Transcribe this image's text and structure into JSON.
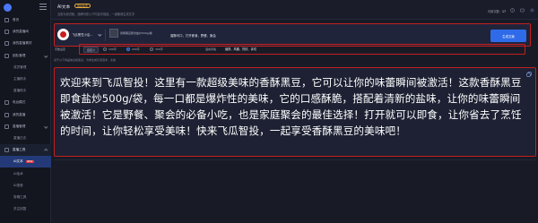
{
  "header": {
    "title": "AI文本",
    "badge": "限时免费",
    "notice": "当前为测试版，品牌可在以下内容中挑选，一键使用生成文字",
    "counter_label": "可用次数：",
    "counter_value": "17"
  },
  "sidebar": {
    "items": [
      {
        "label": "首页",
        "type": "item"
      },
      {
        "label": "我的直播间",
        "type": "item"
      },
      {
        "label": "我的直播素材",
        "type": "item"
      },
      {
        "label": "团队管理",
        "type": "group"
      },
      {
        "label": "成员管理",
        "type": "sub"
      },
      {
        "label": "主播助手",
        "type": "sub"
      },
      {
        "label": "直播助手",
        "type": "sub"
      },
      {
        "label": "电台模式",
        "type": "item"
      },
      {
        "label": "我的直播",
        "type": "item"
      },
      {
        "label": "直播管理",
        "type": "group"
      },
      {
        "label": "直播日志",
        "type": "sub"
      },
      {
        "label": "直播工具",
        "type": "group-open"
      },
      {
        "label": "AI文本",
        "type": "active",
        "badge": "NEW"
      },
      {
        "label": "AI话术",
        "type": "sub"
      },
      {
        "label": "AI语音",
        "type": "sub"
      },
      {
        "label": "剪辑工具",
        "type": "sub"
      },
      {
        "label": "关注回复",
        "type": "sub"
      }
    ]
  },
  "input_bar": {
    "product_select": "飞瓜黑豆小店...",
    "product_title": "香酥黑豆即食盐炒500g/袋",
    "selling_points": "香酥可口，打开即食，野餐、聚会",
    "generate_label": "生成文案"
  },
  "options": {
    "word_count_label": "字数设定",
    "word_button": "自定义",
    "radio_short": "100字",
    "radio_medium": "200字",
    "radio_long": "300字",
    "style_label": "语言风格",
    "style_value": "幽默、风趣、热情、亲切"
  },
  "hint": "基于以下商品信息和卖点，为你生成引流话术、文案",
  "result": {
    "text": "欢迎来到飞瓜智投！这里有一款超级美味的香酥黑豆，它可以让你的味蕾瞬间被激活！这款香酥黑豆即食盐炒500g/袋，每一口都是爆炸性的美味，它的口感酥脆，搭配着清新的盐味，让你的味蕾瞬间被激活！它是野餐、聚会的必备小吃，也是家庭聚会的最佳选择！打开就可以即食，让你省去了烹饪的时间，让你轻松享受美味！快来飞瓜智投，一起享受香酥黑豆的美味吧！"
  },
  "colors": {
    "accent": "#2f6be8",
    "highlight_border": "#c41f1f",
    "background": "#181b26"
  }
}
